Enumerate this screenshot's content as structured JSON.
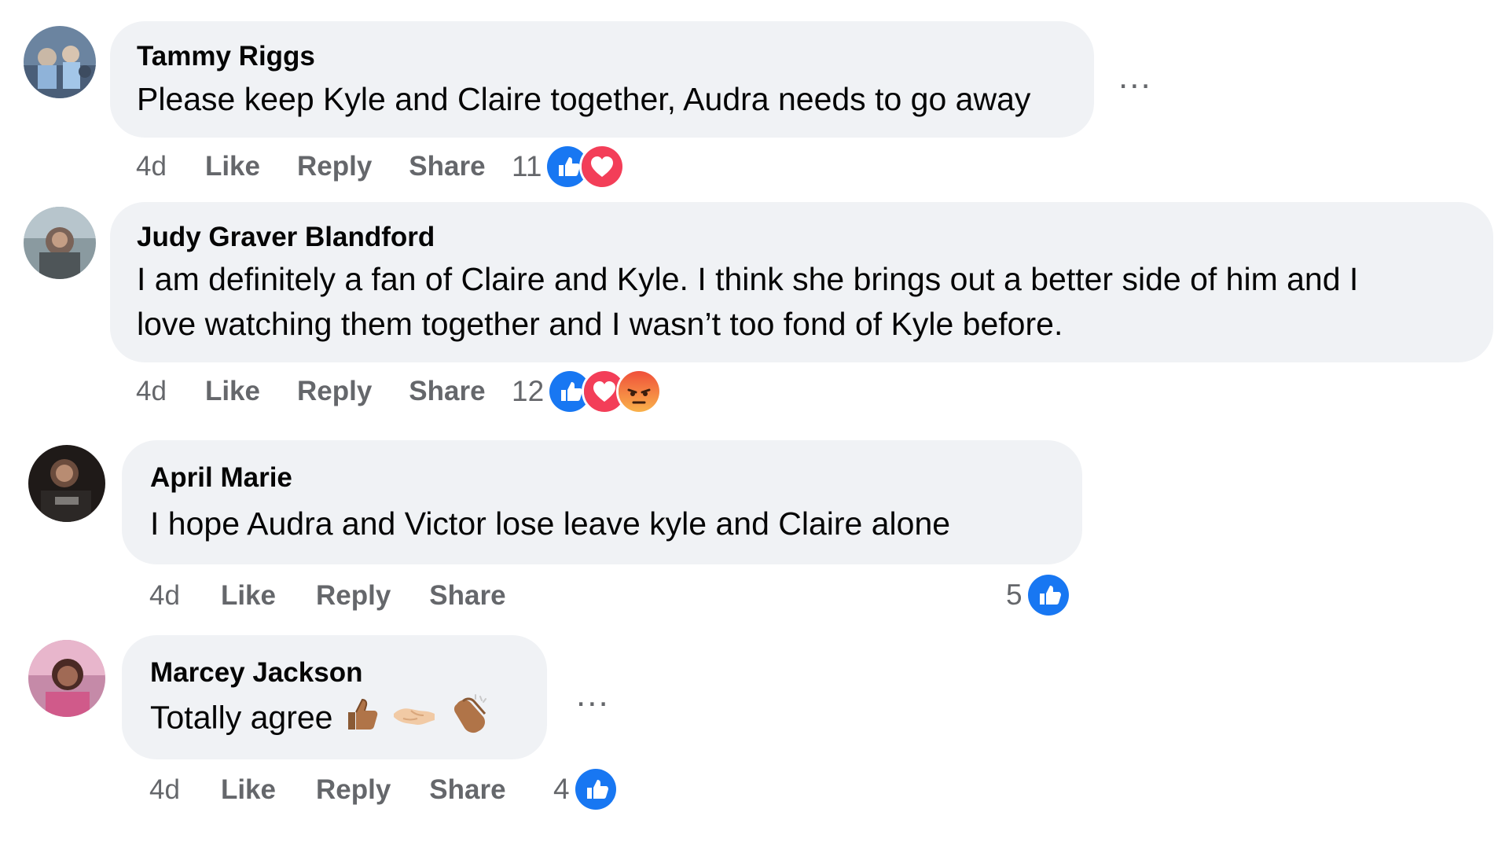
{
  "comments": [
    {
      "author": "Tammy Riggs",
      "lines": [
        "Please keep Kyle and Claire together, Audra needs to go away"
      ],
      "time": "4d",
      "like": "Like",
      "reply": "Reply",
      "share": "Share",
      "reaction_count": "11",
      "reactions": [
        "like-icon",
        "love-icon"
      ]
    },
    {
      "author": "Judy Graver Blandford",
      "lines": [
        "I am definitely a fan of Claire and Kyle. I think she brings out a better side of him and I",
        "love watching them together and I wasn’t too fond of Kyle before."
      ],
      "time": "4d",
      "like": "Like",
      "reply": "Reply",
      "share": "Share",
      "reaction_count": "12",
      "reactions": [
        "like-icon",
        "love-icon",
        "angry-icon"
      ]
    },
    {
      "author": "April Marie",
      "lines": [
        "I hope Audra and Victor lose leave kyle and Claire alone"
      ],
      "time": "4d",
      "like": "Like",
      "reply": "Reply",
      "share": "Share",
      "reaction_count": "5",
      "reactions": [
        "like-icon"
      ]
    },
    {
      "author": "Marcey Jackson",
      "lines": [
        "Totally agree"
      ],
      "emojis": [
        "thumbs-up-emoji",
        "handshake-emoji",
        "clapping-hands-emoji"
      ],
      "time": "4d",
      "like": "Like",
      "reply": "Reply",
      "share": "Share",
      "reaction_count": "4",
      "reactions": [
        "like-icon"
      ]
    }
  ],
  "more_options_label": "...",
  "colors": {
    "bubble": "#f0f2f5",
    "meta_text": "#65676b",
    "like_blue": "#1877f2",
    "love_red": "#f33e58",
    "angry_orange": "#e9710f"
  }
}
